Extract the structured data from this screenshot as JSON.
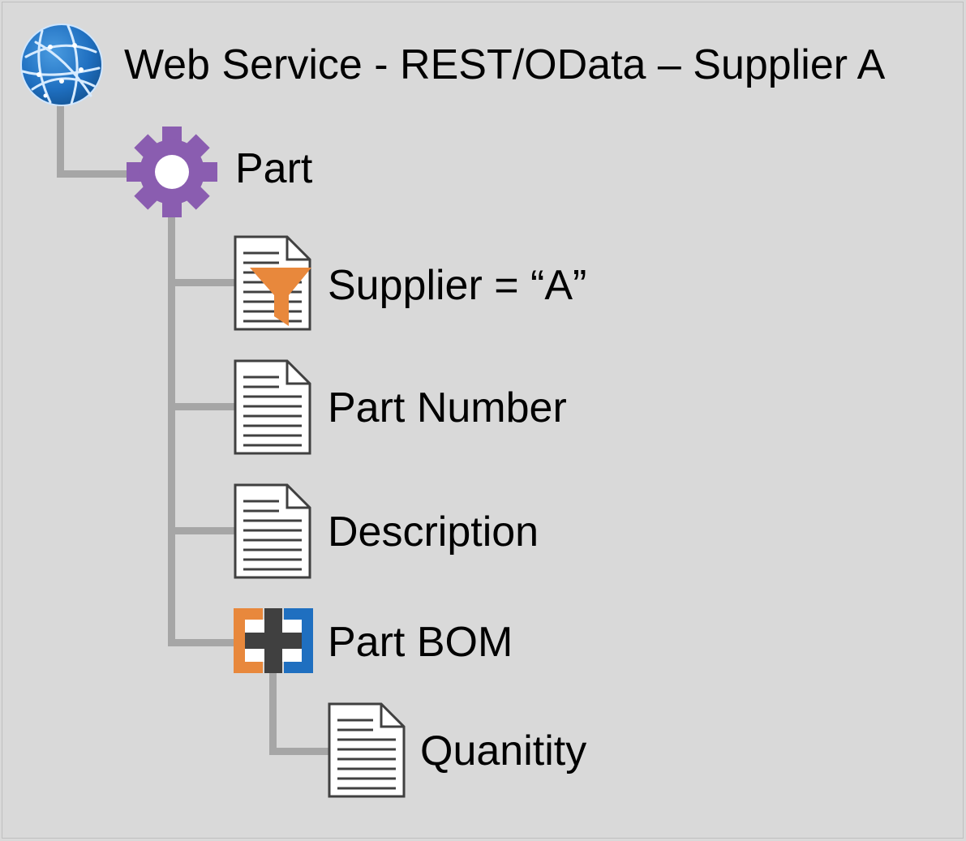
{
  "colors": {
    "background": "#d9d9d9",
    "connector": "#a6a6a6",
    "globe": "#1f6fc0",
    "gear": "#8a5db0",
    "filter": "#e8883c",
    "bom_orange": "#e8883c",
    "bom_blue": "#1f6fc0",
    "bom_cross": "#404040"
  },
  "tree": {
    "root": {
      "label": "Web Service - REST/OData – Supplier A",
      "icon": "globe-icon"
    },
    "entity": {
      "label": "Part",
      "icon": "gear-icon"
    },
    "fields": [
      {
        "label": "Supplier = “A”",
        "icon": "filtered-document-icon"
      },
      {
        "label": "Part Number",
        "icon": "document-icon"
      },
      {
        "label": "Description",
        "icon": "document-icon"
      },
      {
        "label": "Part BOM",
        "icon": "bom-icon"
      }
    ],
    "child": {
      "label": "Quanitity",
      "icon": "document-icon"
    }
  }
}
